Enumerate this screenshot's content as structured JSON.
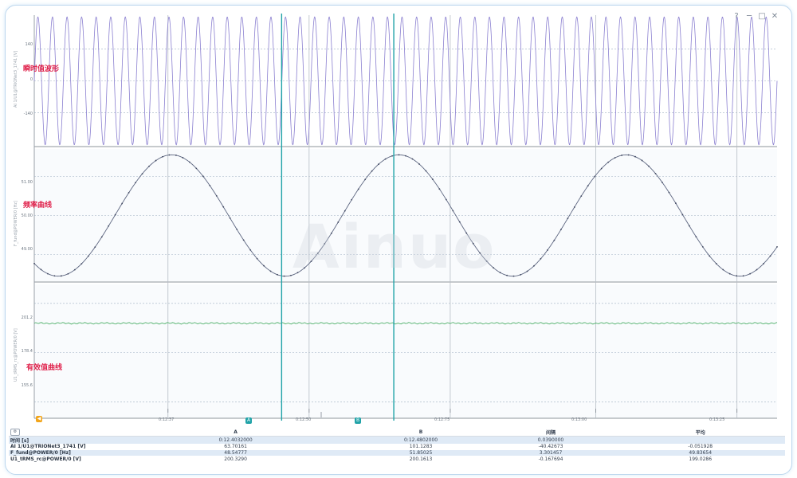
{
  "window_controls": [
    "?",
    "─",
    "□",
    "✕"
  ],
  "watermark": "Ainuo",
  "panels": [
    {
      "label": "瞬时值波形",
      "channel": "AI 1/U1@TRIONet3_1741 [V]",
      "yticks": [
        {
          "v": 140,
          "t": "140"
        },
        {
          "v": 0,
          "t": "0"
        },
        {
          "v": -140,
          "t": "-140"
        }
      ],
      "ylim": [
        -290,
        290
      ]
    },
    {
      "label": "频率曲线",
      "channel": "F_fund@POWER/0 [Hz]",
      "yticks": [
        {
          "v": 51.0,
          "t": "51.00"
        },
        {
          "v": 50.0,
          "t": "50.00"
        },
        {
          "v": 49.0,
          "t": "49.00"
        }
      ],
      "ylim": [
        48.3,
        51.7
      ]
    },
    {
      "label": "有效值曲线",
      "channel": "U1_tRMS_rc@POWER/0 [V]",
      "yticks": [
        {
          "v": 201.2,
          "t": "201.2"
        },
        {
          "v": 178.4,
          "t": "178.4"
        },
        {
          "v": 155.6,
          "t": "155.6"
        }
      ],
      "ylim": [
        148,
        210
      ]
    }
  ],
  "x_ticks": [
    {
      "frac": 0.18,
      "t": "0:12:37"
    },
    {
      "frac": 0.37,
      "t": "0:12:50"
    },
    {
      "frac": 0.56,
      "t": "0:12:75"
    },
    {
      "frac": 0.756,
      "t": "0:13:00"
    },
    {
      "frac": 0.946,
      "t": "0:13:25"
    }
  ],
  "cursors": {
    "a_label": "A",
    "b_label": "B",
    "left_marker": "◀",
    "a_frac": 0.333,
    "b_frac": 0.484,
    "color": "#21a3a8"
  },
  "chart_data": [
    {
      "type": "line",
      "title": "瞬时值波形",
      "ylabel": "AI 1/U1@TRIONet3_1741 [V]",
      "series": [
        {
          "name": "AI 1/U1@TRIONet3_1741 [V]",
          "waveform": "sine",
          "amplitude": 282,
          "cycles": 51,
          "color": "#8a7fd0"
        }
      ],
      "ylim": [
        -290,
        290
      ],
      "grid": true
    },
    {
      "type": "line",
      "title": "频率曲线",
      "ylabel": "F_fund@POWER/0 [Hz]",
      "series": [
        {
          "name": "F_fund@POWER/0 [Hz]",
          "waveform": "sine",
          "center": 50.0,
          "amplitude": 1.55,
          "period_fraction": 0.306,
          "peak_fraction": 0.185,
          "color": "#5d6680"
        }
      ],
      "ylim": [
        48.3,
        51.7
      ],
      "grid": true
    },
    {
      "type": "line",
      "title": "有效值曲线",
      "ylabel": "U1_tRMS_rc@POWER/0 [V]",
      "series": [
        {
          "name": "U1_tRMS_rc@POWER/0 [V]",
          "waveform": "flat",
          "value": 192.0,
          "color": "#4fb06a"
        }
      ],
      "ylim": [
        148,
        210
      ],
      "grid": true
    }
  ],
  "table": {
    "headers": [
      "",
      "A",
      "B",
      "间隔",
      "平均"
    ],
    "rows": [
      {
        "name": "时间 [s]",
        "a": "0:12.4032000",
        "b": "0:12.4802000",
        "delta": "0.0390000",
        "avg": ""
      },
      {
        "name": "AI 1/U1@TRIONet3_1741 [V]",
        "a": "63.70161",
        "b": "101.1283",
        "delta": "-40.42673",
        "avg": "-0.051928"
      },
      {
        "name": "F_fund@POWER/0 [Hz]",
        "a": "48.54777",
        "b": "51.85025",
        "delta": "3.301457",
        "avg": "49.83654"
      },
      {
        "name": "U1_tRMS_rc@POWER/0 [V]",
        "a": "200.3290",
        "b": "200.1613",
        "delta": "-0.167694",
        "avg": "199.0286"
      }
    ]
  }
}
